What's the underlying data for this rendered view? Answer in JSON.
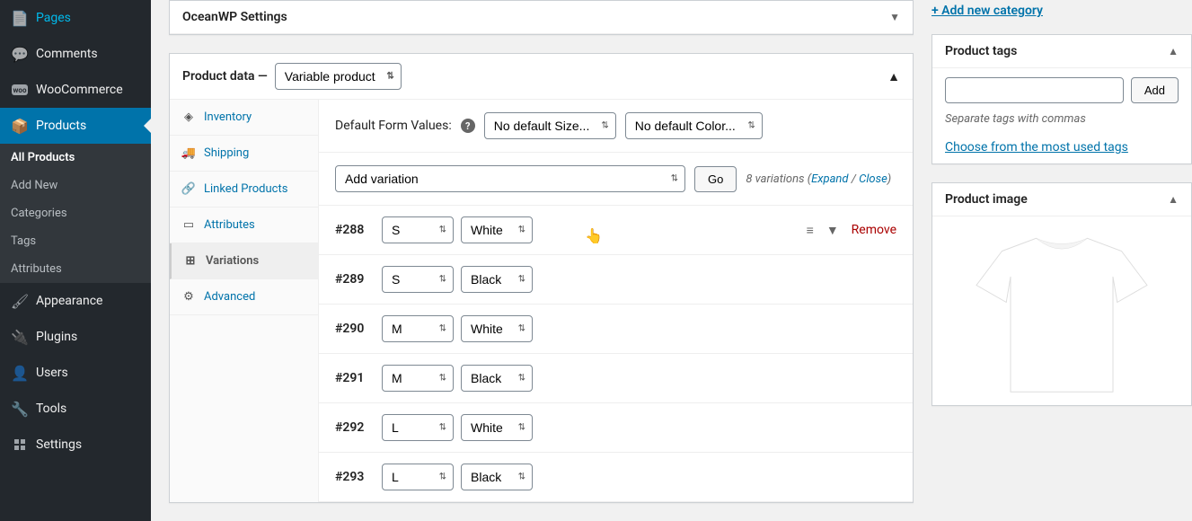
{
  "sidebar": {
    "items": [
      {
        "label": "Pages",
        "icon": "📄"
      },
      {
        "label": "Comments",
        "icon": "💬"
      },
      {
        "label": "WooCommerce",
        "icon": "woo"
      },
      {
        "label": "Products",
        "icon": "📦",
        "active": true
      },
      {
        "label": "Appearance",
        "icon": "🖌"
      },
      {
        "label": "Plugins",
        "icon": "🔌"
      },
      {
        "label": "Users",
        "icon": "👤"
      },
      {
        "label": "Tools",
        "icon": "🔧"
      },
      {
        "label": "Settings",
        "icon": "⚙"
      }
    ],
    "submenu": [
      {
        "label": "All Products",
        "active": true
      },
      {
        "label": "Add New"
      },
      {
        "label": "Categories"
      },
      {
        "label": "Tags"
      },
      {
        "label": "Attributes"
      }
    ]
  },
  "ocean_panel": {
    "title": "OceanWP Settings"
  },
  "product_data": {
    "label": "Product data —",
    "type": "Variable product",
    "tabs": [
      {
        "label": "Inventory",
        "icon": "◈"
      },
      {
        "label": "Shipping",
        "icon": "🚚"
      },
      {
        "label": "Linked Products",
        "icon": "🔗"
      },
      {
        "label": "Attributes",
        "icon": "▭"
      },
      {
        "label": "Variations",
        "icon": "⊞",
        "active": true
      },
      {
        "label": "Advanced",
        "icon": "⚙"
      }
    ],
    "default_form_label": "Default Form Values:",
    "default_size": "No default Size...",
    "default_color": "No default Color...",
    "add_variation": "Add variation",
    "go_label": "Go",
    "variations_count": "8 variations",
    "expand_label": "Expand",
    "close_label": "Close",
    "remove_label": "Remove",
    "variations": [
      {
        "id": "#288",
        "size": "S",
        "color": "White",
        "hover": true
      },
      {
        "id": "#289",
        "size": "S",
        "color": "Black"
      },
      {
        "id": "#290",
        "size": "M",
        "color": "White"
      },
      {
        "id": "#291",
        "size": "M",
        "color": "Black"
      },
      {
        "id": "#292",
        "size": "L",
        "color": "White"
      },
      {
        "id": "#293",
        "size": "L",
        "color": "Black"
      }
    ]
  },
  "right": {
    "add_category": "+ Add new category",
    "tags_title": "Product tags",
    "add_btn": "Add",
    "tags_help": "Separate tags with commas",
    "tags_link": "Choose from the most used tags",
    "image_title": "Product image"
  }
}
